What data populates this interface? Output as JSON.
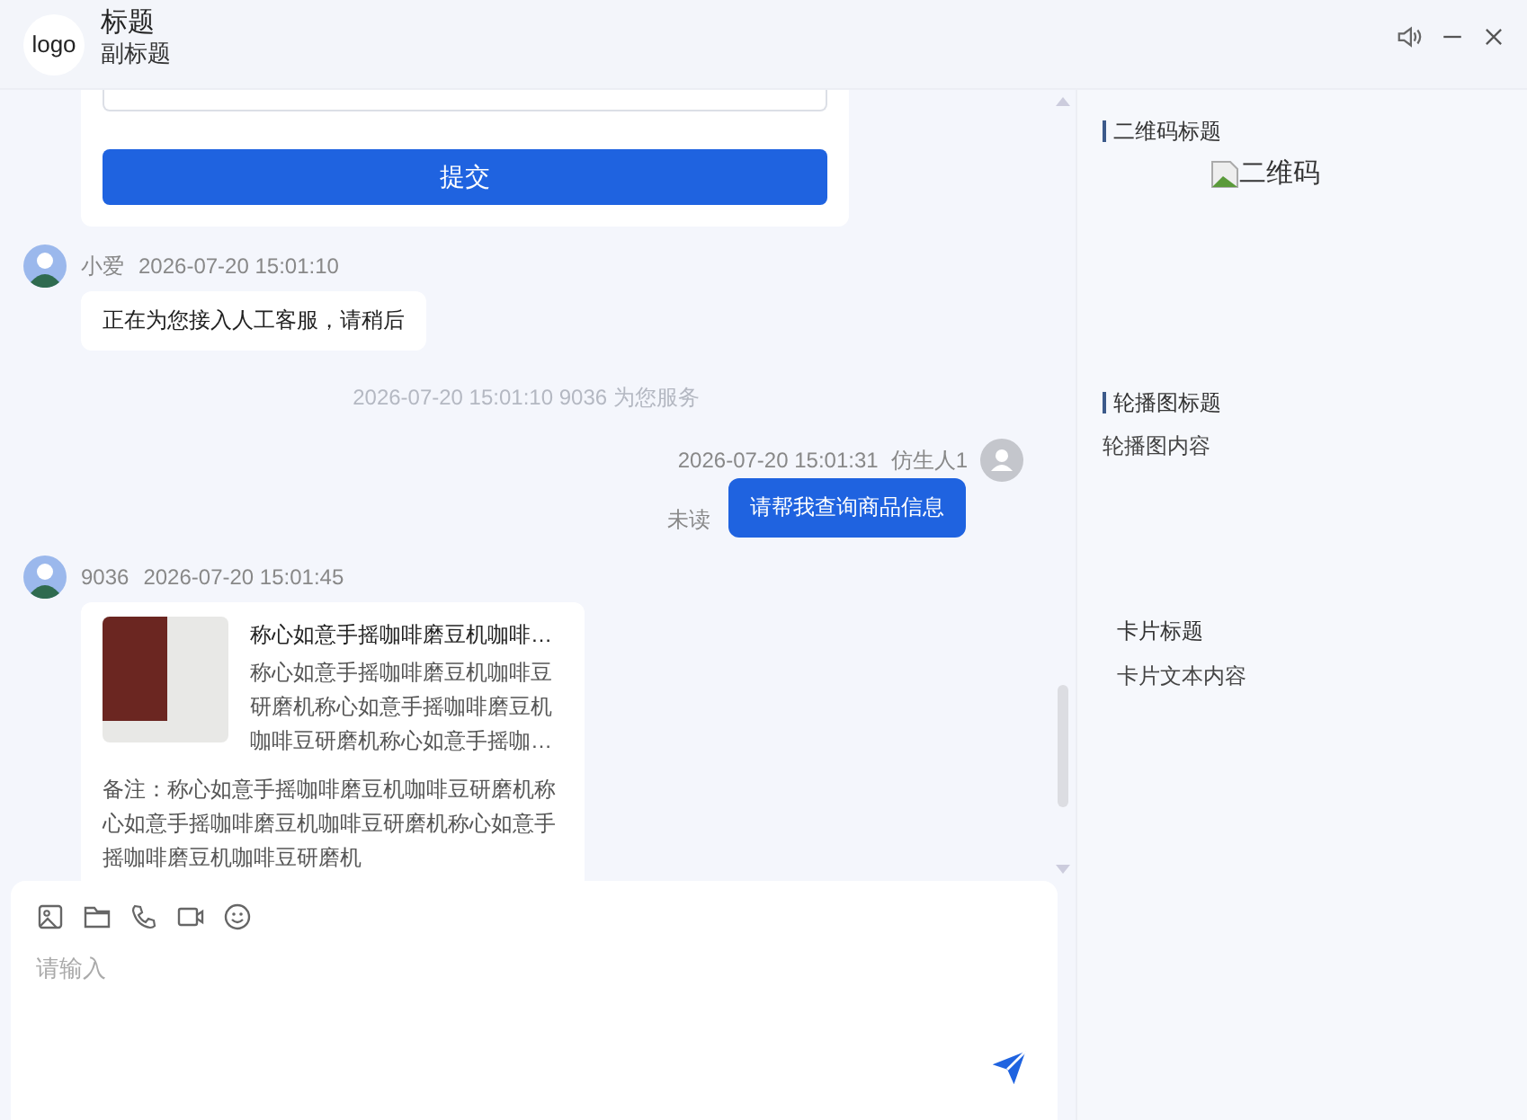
{
  "header": {
    "logo": "logo",
    "title": "标题",
    "subtitle": "副标题"
  },
  "messages": [
    {
      "kind": "form",
      "button": "提交"
    },
    {
      "kind": "incoming",
      "sender": "小爱",
      "time": "2026-07-20 15:01:10",
      "text": "正在为您接入人工客服，请稍后"
    },
    {
      "kind": "system",
      "text": "2026-07-20 15:01:10 9036 为您服务"
    },
    {
      "kind": "outgoing",
      "time": "2026-07-20 15:01:31",
      "sender": "仿生人1",
      "status": "未读",
      "text": "请帮我查询商品信息"
    },
    {
      "kind": "product",
      "sender": "9036",
      "time": "2026-07-20 15:01:45",
      "title": "称心如意手摇咖啡磨豆机咖啡…",
      "description": "称心如意手摇咖啡磨豆机咖啡豆研磨机称心如意手摇咖啡磨豆机咖啡豆研磨机称心如意手摇咖…",
      "note": "备注：称心如意手摇咖啡磨豆机咖啡豆研磨机称心如意手摇咖啡磨豆机咖啡豆研磨机称心如意手摇咖啡磨豆机咖啡豆研磨机"
    }
  ],
  "composer": {
    "placeholder": "请输入"
  },
  "side_panel": {
    "qr_title": "二维码标题",
    "qr_alt": "二维码",
    "carousel_title": "轮播图标题",
    "carousel_content": "轮播图内容",
    "card_title": "卡片标题",
    "card_text": "卡片文本内容"
  }
}
